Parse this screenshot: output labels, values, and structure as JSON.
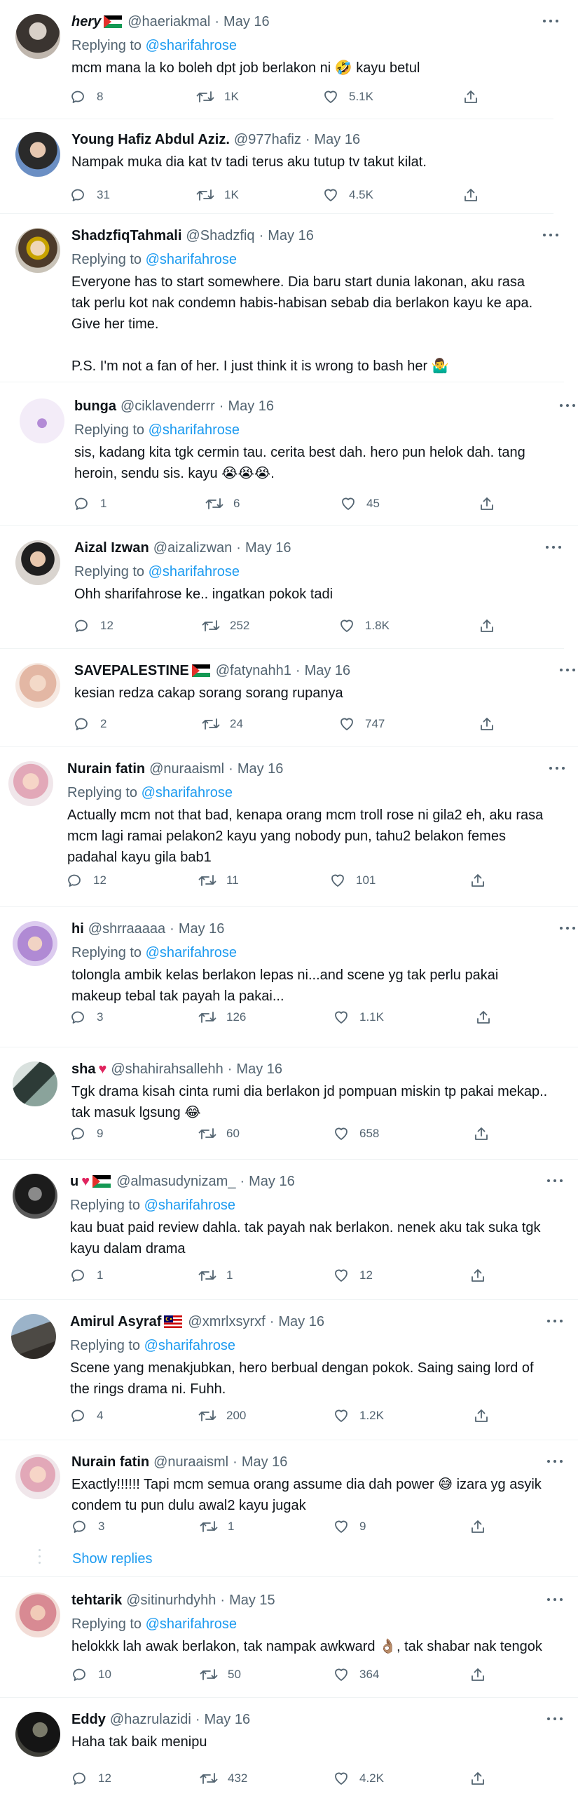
{
  "colors": {
    "accent": "#1d9bf0",
    "muted": "#536471",
    "text": "#0f1419",
    "like": "#e0245e"
  },
  "icons": {
    "reply": "reply-icon",
    "retweet": "retweet-icon",
    "like": "heart-icon",
    "share": "share-icon",
    "more": "more-icon"
  },
  "tweets": [
    {
      "name": "hery",
      "flag": "palestine",
      "handle": "@haeriakmal",
      "date": "May 16",
      "replying_label": "Replying to",
      "replying_to": "@sharifahrose",
      "text": "mcm mana la ko boleh dpt job berlakon ni 🤣 kayu betul",
      "replies": "8",
      "retweets": "1K",
      "likes": "5.1K"
    },
    {
      "name": "Young Hafiz Abdul Aziz.",
      "handle": "@977hafiz",
      "date": "May 16",
      "text": "Nampak muka dia kat tv tadi terus aku tutup tv takut kilat.",
      "replies": "31",
      "retweets": "1K",
      "likes": "4.5K"
    },
    {
      "name": "ShadzfiqTahmali",
      "handle": "@Shadzfiq",
      "date": "May 16",
      "replying_label": "Replying to",
      "replying_to": "@sharifahrose",
      "text": "Everyone has to start somewhere. Dia baru start dunia lakonan, aku rasa tak perlu kot nak condemn habis-habisan sebab dia berlakon kayu ke apa. Give her time.\n\nP.S. I'm not a fan of her. I just think it is wrong to bash her 🤷‍♂️"
    },
    {
      "name": "bunga",
      "handle": "@ciklavenderrr",
      "date": "May 16",
      "replying_label": "Replying to",
      "replying_to": "@sharifahrose",
      "text": "sis, kadang kita tgk cermin tau. cerita best dah. hero pun helok dah. tang heroin, sendu sis. kayu 😭😭😭.",
      "replies": "1",
      "retweets": "6",
      "likes": "45"
    },
    {
      "name": "Aizal Izwan",
      "handle": "@aizalizwan",
      "date": "May 16",
      "replying_label": "Replying to",
      "replying_to": "@sharifahrose",
      "text": "Ohh sharifahrose ke.. ingatkan pokok tadi",
      "replies": "12",
      "retweets": "252",
      "likes": "1.8K"
    },
    {
      "name": "SAVEPALESTINE",
      "flag": "palestine",
      "handle": "@fatynahh1",
      "date": "May 16",
      "text": "kesian redza cakap sorang sorang rupanya",
      "replies": "2",
      "retweets": "24",
      "likes": "747"
    },
    {
      "name": "Nurain fatin",
      "handle": "@nuraaisml",
      "date": "May 16",
      "replying_label": "Replying to",
      "replying_to": "@sharifahrose",
      "text": "Actually mcm not that bad, kenapa orang mcm troll rose ni gila2 eh, aku rasa mcm lagi ramai pelakon2 kayu yang nobody pun, tahu2 belakon femes padahal kayu gila bab1",
      "replies": "12",
      "retweets": "11",
      "likes": "101"
    },
    {
      "name": "hi",
      "handle": "@shrraaaaa",
      "date": "May 16",
      "replying_label": "Replying to",
      "replying_to": "@sharifahrose",
      "text": "tolongla ambik kelas berlakon lepas ni...and scene yg tak perlu pakai makeup tebal tak payah la pakai...",
      "replies": "3",
      "retweets": "126",
      "likes": "1.1K"
    },
    {
      "name": "sha",
      "heart": "♥",
      "handle": "@shahirahsallehh",
      "date": "May 16",
      "text": "Tgk drama kisah cinta rumi dia berlakon jd pompuan miskin tp pakai mekap.. tak masuk lgsung 😂",
      "replies": "9",
      "retweets": "60",
      "likes": "658"
    },
    {
      "name": "u",
      "heart": "♥",
      "flag": "palestine",
      "handle": "@almasudynizam_",
      "date": "May 16",
      "replying_label": "Replying to",
      "replying_to": "@sharifahrose",
      "text": "kau buat paid review dahla. tak payah nak berlakon. nenek aku tak suka tgk kayu dalam drama",
      "replies": "1",
      "retweets": "1",
      "likes": "12"
    },
    {
      "name": "Amirul Asyraf",
      "flag": "malaysia",
      "handle": "@xmrlxsyrxf",
      "date": "May 16",
      "replying_label": "Replying to",
      "replying_to": "@sharifahrose",
      "text": "Scene yang menakjubkan, hero berbual dengan pokok. Saing saing lord of the rings drama ni. Fuhh.",
      "replies": "4",
      "retweets": "200",
      "likes": "1.2K"
    },
    {
      "name": "Nurain fatin",
      "handle": "@nuraaisml",
      "date": "May 16",
      "text": "Exactly!!!!!! Tapi mcm semua orang assume dia dah power 😅 izara yg asyik condem tu pun dulu awal2 kayu jugak",
      "replies": "3",
      "retweets": "1",
      "likes": "9"
    },
    {
      "name": "tehtarik",
      "handle": "@sitinurhdyhh",
      "date": "May 15",
      "replying_label": "Replying to",
      "replying_to": "@sharifahrose",
      "text": "helokkk lah awak berlakon, tak nampak awkward 👌🏽, tak shabar nak tengok",
      "replies": "10",
      "retweets": "50",
      "likes": "364"
    },
    {
      "name": "Eddy",
      "handle": "@hazrulazidi",
      "date": "May 16",
      "text": "Haha tak baik menipu",
      "replies": "12",
      "retweets": "432",
      "likes": "4.2K"
    }
  ],
  "show_replies": {
    "label": "Show replies"
  }
}
